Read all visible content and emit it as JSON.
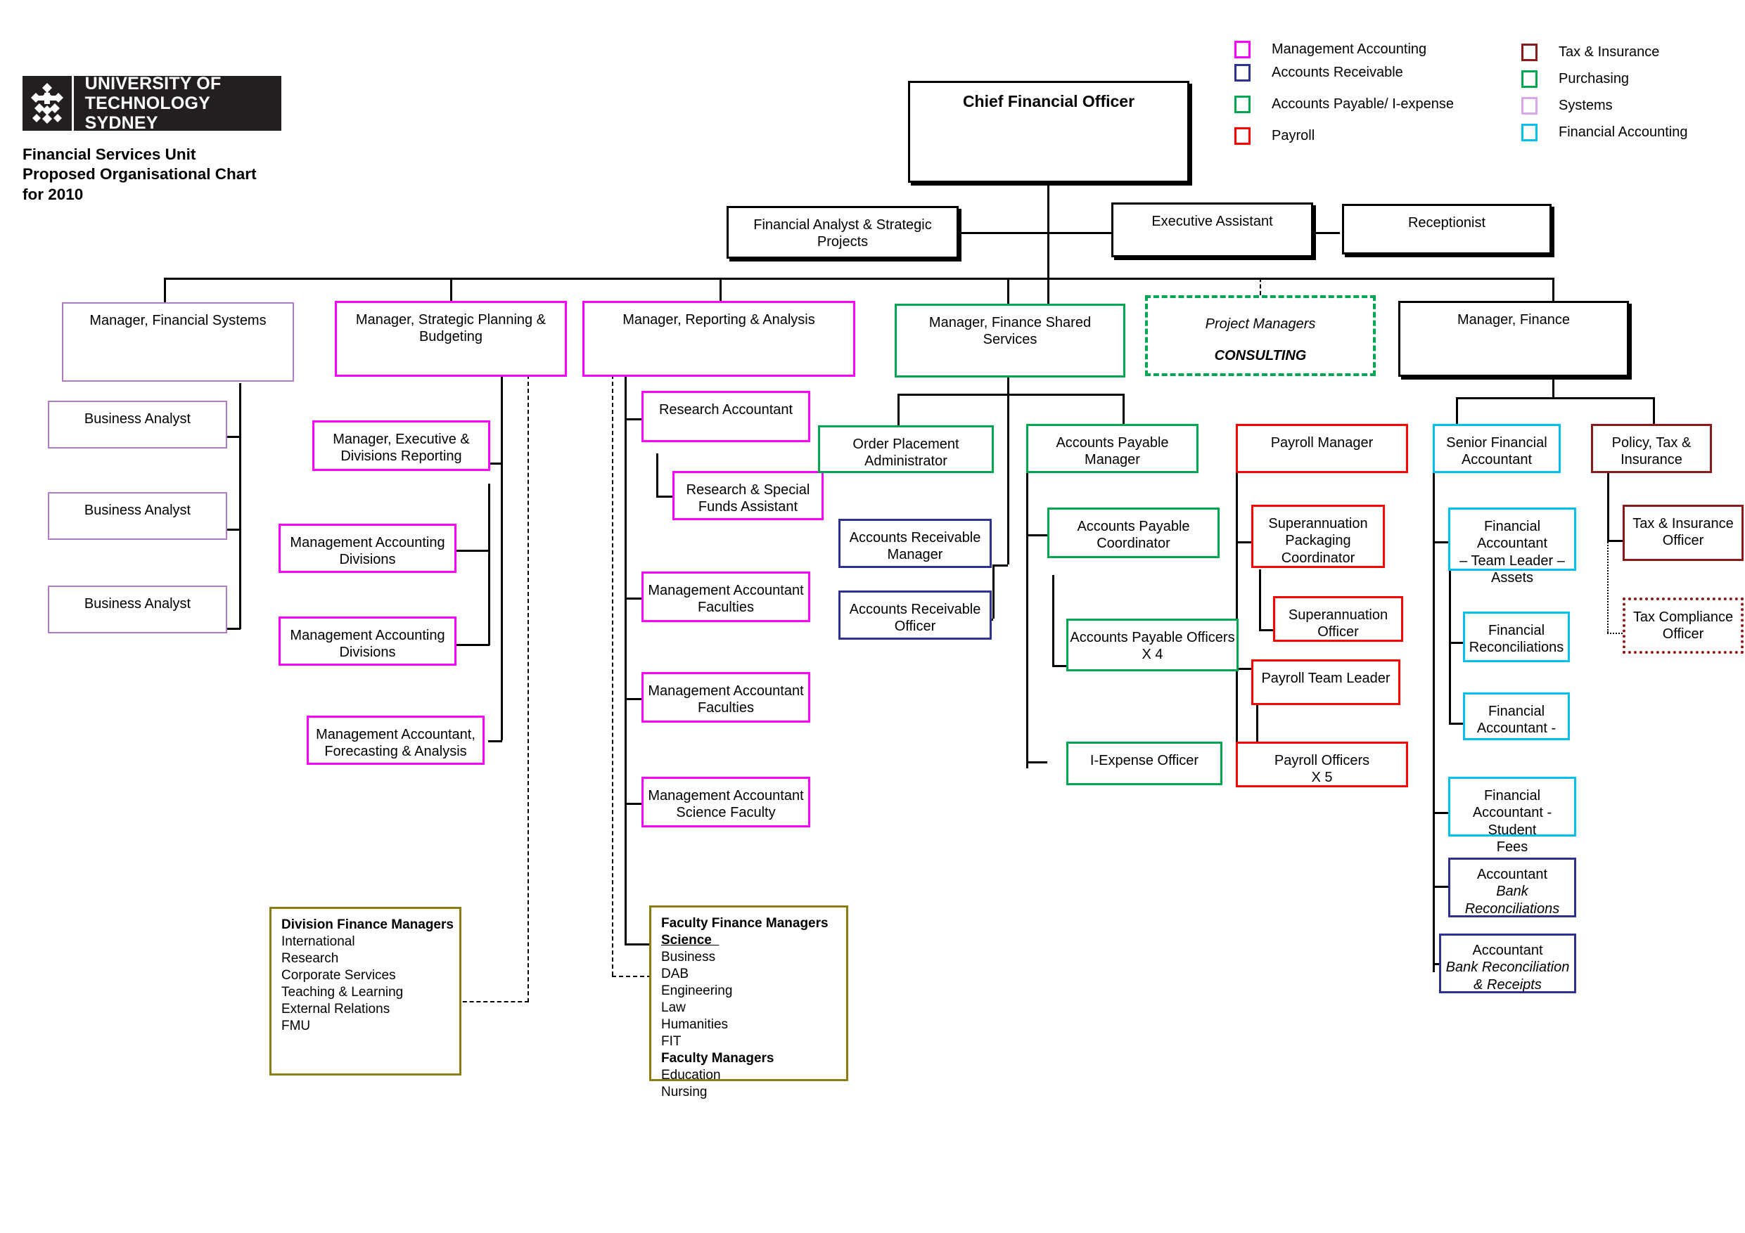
{
  "brand": {
    "logo_line1": "UNIVERSITY OF",
    "logo_line2": "TECHNOLOGY SYDNEY",
    "logo_icon": "uts-diamond-logo"
  },
  "title": "Financial Services Unit\nProposed Organisational Chart\nfor 2010",
  "legend": {
    "left": [
      {
        "label": "Management Accounting",
        "color": "#ff00ff"
      },
      {
        "label": "Accounts Receivable",
        "color": "#2e3192"
      },
      {
        "label": "Accounts Payable/ I-expense",
        "color": "#00a651"
      },
      {
        "label": "Payroll",
        "color": "#ff0000"
      }
    ],
    "right": [
      {
        "label": "Tax & Insurance",
        "color": "#8b1a1a"
      },
      {
        "label": "Purchasing",
        "color": "#00a651"
      },
      {
        "label": "Systems",
        "color": "#d9a8e8"
      },
      {
        "label": "Financial Accounting",
        "color": "#00c0f0"
      }
    ]
  },
  "chart_data": {
    "type": "org-chart",
    "title": "Financial Services Unit Proposed Organisational Chart for 2010",
    "nodes": {
      "cfo": "Chief Financial Officer",
      "financial_analyst": "Financial Analyst & Strategic\nProjects",
      "executive_assistant": "Executive Assistant",
      "receptionist": "Receptionist",
      "mgr_financial_systems": "Manager, Financial Systems",
      "mgr_strategic_planning": "Manager, Strategic Planning &\nBudgeting",
      "mgr_reporting_analysis": "Manager, Reporting & Analysis",
      "mgr_finance_shared": "Manager, Finance Shared\nServices",
      "project_managers_l1": "Project Managers",
      "project_managers_l2": "CONSULTING",
      "mgr_finance": "Manager, Finance",
      "business_analyst_1": "Business Analyst",
      "business_analyst_2": "Business Analyst",
      "business_analyst_3": "Business Analyst",
      "mgr_exec_divisions_reporting": "Manager, Executive &\nDivisions Reporting",
      "mgmt_acct_divisions_1": "Management Accounting\nDivisions",
      "mgmt_acct_divisions_2": "Management Accounting\nDivisions",
      "mgmt_acct_forecasting": "Management Accountant,\nForecasting & Analysis",
      "research_accountant": "Research Accountant",
      "research_special_funds": "Research & Special\nFunds Assistant",
      "mgmt_acct_faculties_1": "Management Accountant\nFaculties",
      "mgmt_acct_faculties_2": "Management Accountant\nFaculties",
      "mgmt_acct_science": "Management Accountant\nScience Faculty",
      "order_placement_admin": "Order Placement\nAdministrator",
      "ar_manager": "Accounts Receivable\nManager",
      "ar_officer": "Accounts Receivable\nOfficer",
      "ap_manager": "Accounts Payable Manager",
      "ap_coordinator": "Accounts Payable\nCoordinator",
      "ap_officers": "Accounts Payable Officers\nX 4",
      "iexpense_officer": "I-Expense Officer",
      "payroll_manager": "Payroll Manager",
      "super_packaging_coord": "Superannuation\nPackaging\nCoordinator",
      "super_officer": "Superannuation\nOfficer",
      "payroll_team_leader": "Payroll Team Leader",
      "payroll_officers": "Payroll Officers\nX 5",
      "senior_financial_accountant": "Senior Financial\nAccountant",
      "fa_team_leader_assets": "Financial Accountant\n– Team Leader –\nAssets",
      "financial_reconciliations": "Financial\nReconciliations",
      "financial_accountant_dash": "Financial\nAccountant -",
      "fa_student_fees": "Financial\nAccountant -Student\nFees",
      "accountant_bank_rec_l1": "Accountant",
      "accountant_bank_rec_l2": "Bank\nReconciliations",
      "accountant_bank_rec_receipts_l1": "Accountant",
      "accountant_bank_rec_receipts_l2": "Bank Reconciliation\n& Receipts",
      "policy_tax_insurance": "Policy, Tax &\nInsurance",
      "tax_insurance_officer": "Tax & Insurance\nOfficer",
      "tax_compliance_officer": "Tax Compliance\nOfficer"
    },
    "division_finance_managers": {
      "heading": "Division Finance Managers",
      "items": [
        "International",
        "Research",
        "Corporate Services",
        "Teaching & Learning",
        "External Relations",
        "FMU"
      ]
    },
    "faculty_finance_managers": {
      "heading": "Faculty Finance Managers",
      "science": "Science  ",
      "items": [
        "Business",
        "DAB",
        "Engineering",
        "Law",
        "Humanities",
        "FIT"
      ],
      "subheading": "Faculty Managers",
      "sub_items": [
        "Education",
        "Nursing"
      ]
    }
  }
}
